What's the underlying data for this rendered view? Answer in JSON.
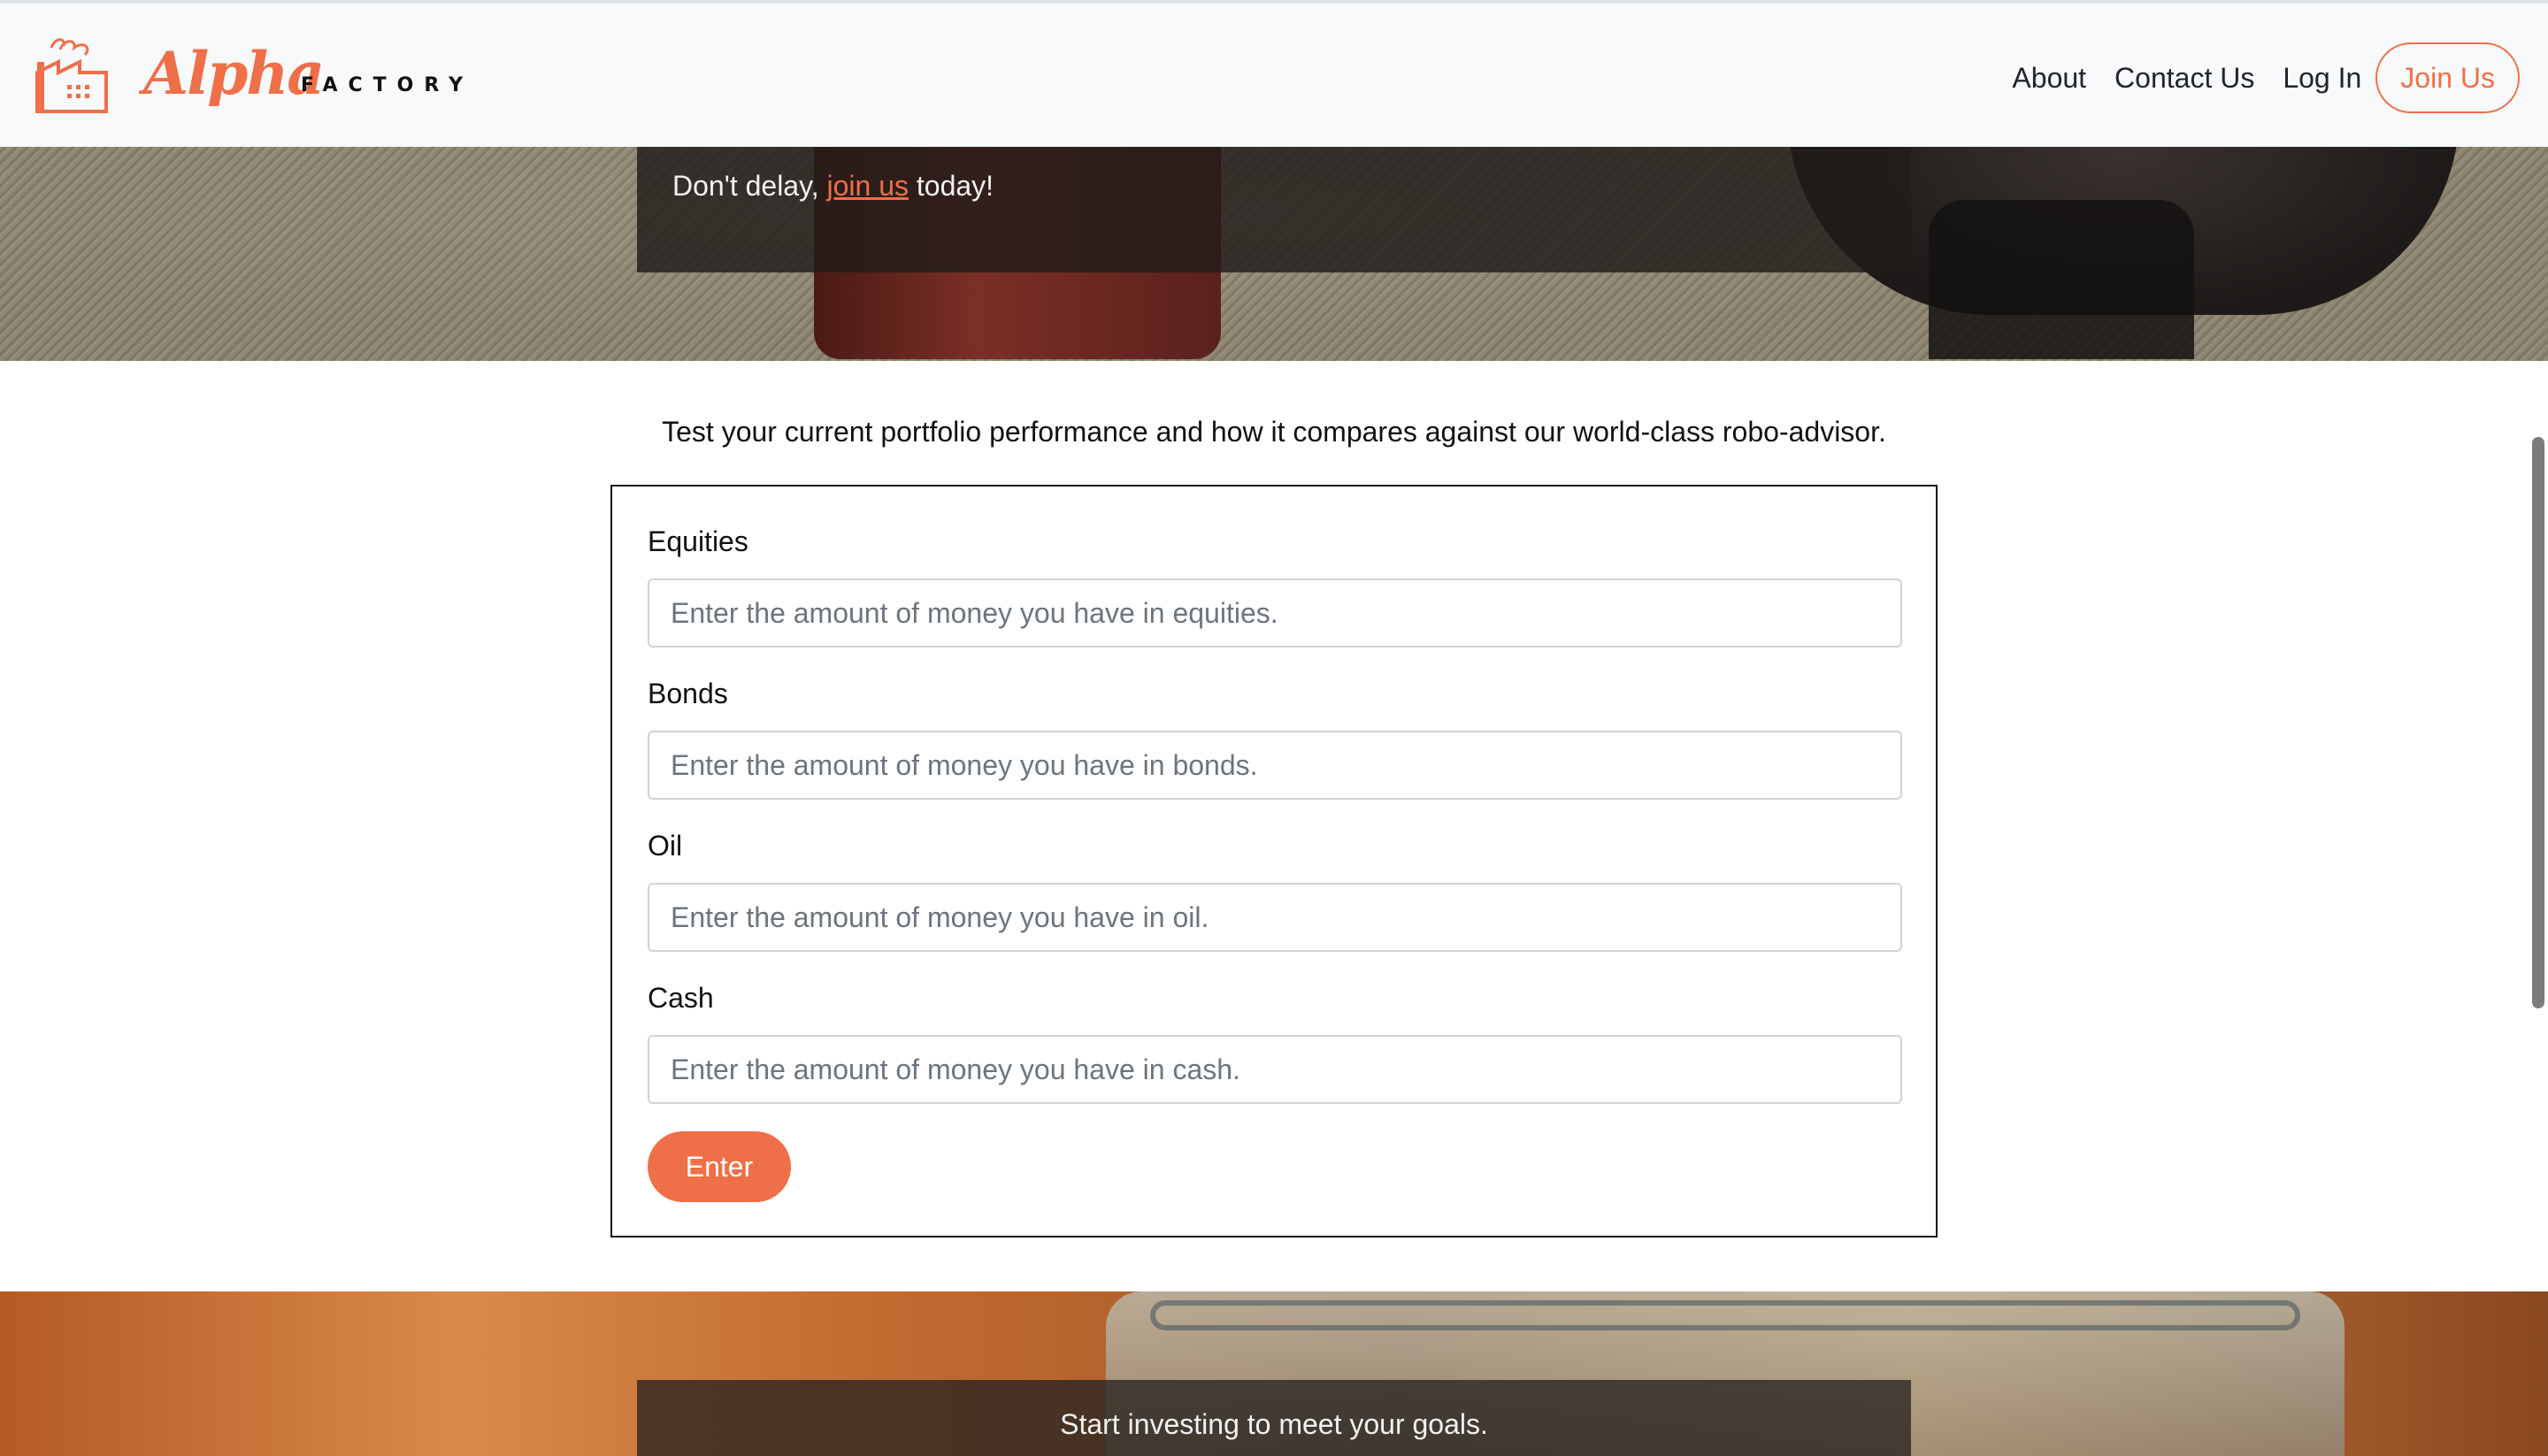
{
  "brand": {
    "name_script": "Alpha",
    "name_caps": "FACTORY",
    "accent_color": "#ef6f48",
    "icon": "factory-icon"
  },
  "nav": {
    "about": "About",
    "contact": "Contact Us",
    "login": "Log In",
    "join": "Join Us"
  },
  "hero_top": {
    "text_before": "Don't delay, ",
    "link": "join us",
    "text_after": " today!"
  },
  "main": {
    "intro": "Test your current portfolio performance and how it compares against our world-class robo-advisor.",
    "fields": [
      {
        "label": "Equities",
        "placeholder": "Enter the amount of money you have in equities."
      },
      {
        "label": "Bonds",
        "placeholder": "Enter the amount of money you have in bonds."
      },
      {
        "label": "Oil",
        "placeholder": "Enter the amount of money you have in oil."
      },
      {
        "label": "Cash",
        "placeholder": "Enter the amount of money you have in cash."
      }
    ],
    "submit_label": "Enter"
  },
  "hero_bottom": {
    "text": "Start investing to meet your goals."
  }
}
